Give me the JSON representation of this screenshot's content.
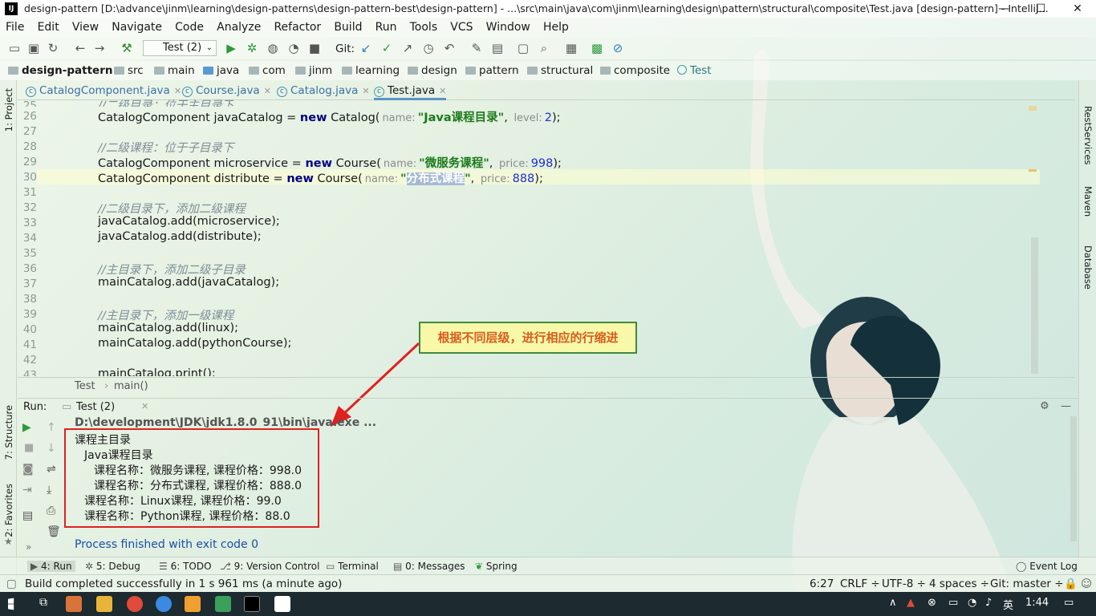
{
  "window": {
    "app_icon": "IJ",
    "title": "design-pattern [D:\\advance\\jinm\\learning\\design-patterns\\design-pattern-best\\design-pattern] - ...\\src\\main\\java\\com\\jinm\\learning\\design\\pattern\\structural\\composite\\Test.java [design-pattern] - IntelliJ...",
    "minimize": "—",
    "maximize": "☐",
    "close": "✕"
  },
  "menu": [
    "File",
    "Edit",
    "View",
    "Navigate",
    "Code",
    "Analyze",
    "Refactor",
    "Build",
    "Run",
    "Tools",
    "VCS",
    "Window",
    "Help"
  ],
  "toolbar": {
    "run_config": "Test (2)",
    "git_label": "Git:"
  },
  "breadcrumb": [
    "design-pattern",
    "src",
    "main",
    "java",
    "com",
    "jinm",
    "learning",
    "design",
    "pattern",
    "structural",
    "composite",
    "Test"
  ],
  "tabs": [
    {
      "label": "CatalogComponent.java"
    },
    {
      "label": "Course.java"
    },
    {
      "label": "Catalog.java"
    },
    {
      "label": "Test.java"
    }
  ],
  "code_lines": [
    {
      "num": "25",
      "partial": "//二级目录：位于主目录下"
    },
    {
      "num": "26",
      "var": "CatalogComponent javaCatalog = ",
      "kw": "new",
      "cls": " Catalog(",
      "h1": "name:",
      "s1": "\"Java课程目录\"",
      "h2": "level:",
      "n2": "2",
      "end": ");"
    },
    {
      "num": "27"
    },
    {
      "num": "28",
      "comment": "//二级课程：位于子目录下"
    },
    {
      "num": "29",
      "var": "CatalogComponent microservice = ",
      "kw": "new",
      "cls": " Course(",
      "h1": "name:",
      "s1": "\"微服务课程\"",
      "h2": "price:",
      "n2": "998",
      "end": ");"
    },
    {
      "num": "30",
      "var": "CatalogComponent distribute = ",
      "kw": "new",
      "cls": " Course(",
      "h1": "name:",
      "s1a": "\"",
      "s1b": "分布式课程",
      "s1c": "\"",
      "h2": "price:",
      "n2": "888",
      "end": ");"
    },
    {
      "num": "31"
    },
    {
      "num": "32",
      "comment": "//二级目录下，添加二级课程"
    },
    {
      "num": "33",
      "plain": "javaCatalog.add(microservice);"
    },
    {
      "num": "34",
      "plain": "javaCatalog.add(distribute);"
    },
    {
      "num": "35"
    },
    {
      "num": "36",
      "comment": "//主目录下，添加二级子目录"
    },
    {
      "num": "37",
      "plain": "mainCatalog.add(javaCatalog);"
    },
    {
      "num": "38"
    },
    {
      "num": "39",
      "comment": "//主目录下，添加一级课程"
    },
    {
      "num": "40",
      "plain": "mainCatalog.add(linux);"
    },
    {
      "num": "41",
      "plain": "mainCatalog.add(pythonCourse);"
    },
    {
      "num": "42"
    },
    {
      "num": "43",
      "plain": "mainCatalog.print();"
    }
  ],
  "editor_breadcrumb": [
    "Test",
    "main()"
  ],
  "annotation": "根据不同层级，进行相应的行缩进",
  "run": {
    "label": "Run:",
    "tab": "Test (2)",
    "command": "D:\\development\\JDK\\jdk1.8.0_91\\bin\\java.exe ...",
    "output": [
      "课程主目录",
      "  Java课程目录",
      "    课程名称：微服务课程, 课程价格：998.0",
      "    课程名称：分布式课程, 课程价格：888.0",
      "  课程名称：Linux课程, 课程价格：99.0",
      "  课程名称：Python课程, 课程价格：88.0"
    ],
    "finished": "Process finished with exit code 0"
  },
  "left_tools": [
    "1: Project",
    "7: Structure",
    "2: Favorites"
  ],
  "right_tools": [
    "RestServices",
    "Maven",
    "Database"
  ],
  "bottom_tools": [
    {
      "label": "4: Run"
    },
    {
      "label": "5: Debug"
    },
    {
      "label": "6: TODO"
    },
    {
      "label": "9: Version Control"
    },
    {
      "label": "Terminal"
    },
    {
      "label": "0: Messages"
    },
    {
      "label": "Spring"
    }
  ],
  "event_log": "Event Log",
  "status": {
    "message": "Build completed successfully in 1 s 961 ms (a minute ago)",
    "position": "6:27",
    "line_sep": "CRLF ÷",
    "encoding": "UTF-8 ÷",
    "indent": "4 spaces ÷",
    "branch": "Git: master ÷"
  },
  "taskbar": {
    "ime": "英",
    "time": "1:44"
  },
  "colors": {
    "keyword": "#000080",
    "string": "#1a7a1a",
    "number": "#1f2ed6",
    "comment": "#7e8e98",
    "annotation_text": "#d95d1c",
    "annotation_bg": "#f7f9a9",
    "red_box": "#e02020",
    "link_blue": "#1a4fa8"
  }
}
